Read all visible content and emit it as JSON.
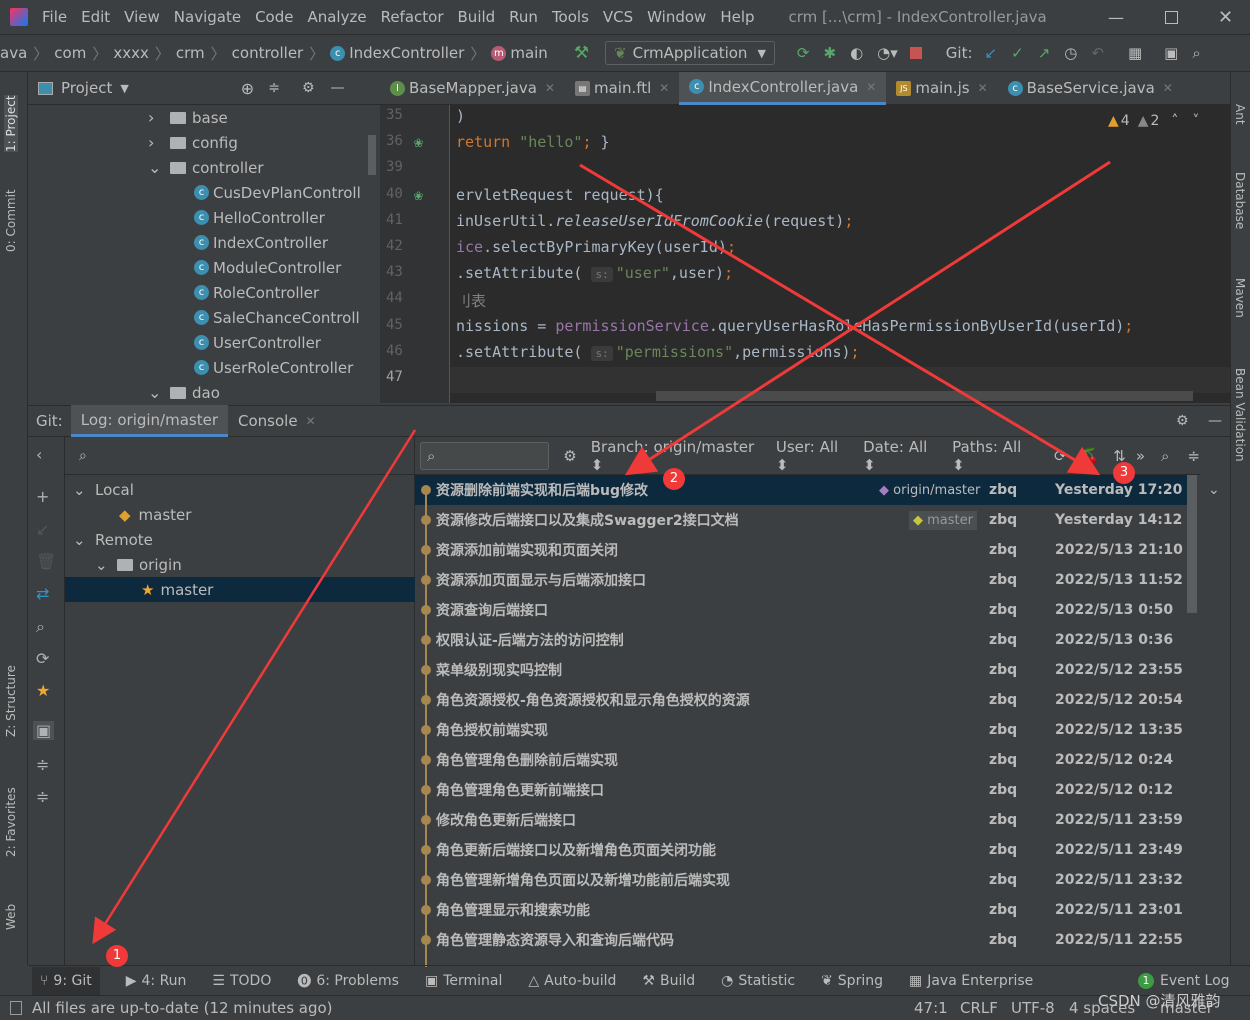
{
  "window": {
    "title": "crm [...\\crm] - IndexController.java"
  },
  "menu": [
    "File",
    "Edit",
    "View",
    "Navigate",
    "Code",
    "Analyze",
    "Refactor",
    "Build",
    "Run",
    "Tools",
    "VCS",
    "Window",
    "Help"
  ],
  "breadcrumb": [
    "ava",
    "com",
    "xxxx",
    "crm",
    "controller",
    "IndexController",
    "main"
  ],
  "run_config": "CrmApplication",
  "git_label": "Git:",
  "project_label": "Project",
  "editor_tabs": [
    "BaseMapper.java",
    "main.ftl",
    "IndexController.java",
    "main.js",
    "BaseService.java"
  ],
  "left_strip": [
    "1: Project",
    "0: Commit",
    "Z: Structure",
    "2: Favorites",
    "Web"
  ],
  "right_strip": [
    "Ant",
    "Database",
    "Maven",
    "Bean Validation"
  ],
  "tree": [
    {
      "label": "base",
      "level": 1,
      "type": "folder",
      "open": false
    },
    {
      "label": "config",
      "level": 1,
      "type": "folder",
      "open": false
    },
    {
      "label": "controller",
      "level": 1,
      "type": "folder",
      "open": true
    },
    {
      "label": "CusDevPlanControll",
      "level": 2,
      "type": "class"
    },
    {
      "label": "HelloController",
      "level": 2,
      "type": "class"
    },
    {
      "label": "IndexController",
      "level": 2,
      "type": "class"
    },
    {
      "label": "ModuleController",
      "level": 2,
      "type": "class"
    },
    {
      "label": "RoleController",
      "level": 2,
      "type": "class"
    },
    {
      "label": "SaleChanceControll",
      "level": 2,
      "type": "class"
    },
    {
      "label": "UserController",
      "level": 2,
      "type": "class"
    },
    {
      "label": "UserRoleController",
      "level": 2,
      "type": "class"
    },
    {
      "label": "dao",
      "level": 1,
      "type": "folder",
      "open": true
    }
  ],
  "editor": {
    "warnings": "4",
    "weak_warnings": "2",
    "lines": [
      {
        "n": "35",
        "html": ")"
      },
      {
        "n": "36",
        "html": "<span class='kw'>return</span> <span class='str'>\"hello\"</span><span class='kw'>;</span> }"
      },
      {
        "n": "39",
        "html": ""
      },
      {
        "n": "40",
        "html": "ervletRequest request){"
      },
      {
        "n": "41",
        "html": "inUserUtil.<span class='it'>releaseUserIdFromCookie</span>(request)<span class='kw'>;</span>"
      },
      {
        "n": "42",
        "html": "<span class='fld'>ice</span>.selectByPrimaryKey(userId)<span class='kw'>;</span>"
      },
      {
        "n": "43",
        "html": ".setAttribute( <span class='hint'>s:</span><span class='str'>\"user\"</span>,user)<span class='kw'>;</span>"
      },
      {
        "n": "44",
        "html": "<span style='color:#808080'>刂表</span>"
      },
      {
        "n": "45",
        "html": "nissions = <span class='fld'>permissionService</span>.queryUserHasRoleHasPermissionByUserId(userId)<span class='kw'>;</span>"
      },
      {
        "n": "46",
        "html": ".setAttribute( <span class='hint'>s:</span><span class='str'>\"permissions\"</span>,permissions)<span class='kw'>;</span>"
      },
      {
        "n": "47",
        "html": ""
      }
    ]
  },
  "git_panel": {
    "label": "Git:",
    "tabs": [
      "Log: origin/master",
      "Console"
    ]
  },
  "branches": {
    "local": "Local",
    "local_master": "master",
    "remote": "Remote",
    "origin": "origin",
    "origin_master": "master"
  },
  "log_toolbar": {
    "branch": "Branch: origin/master",
    "user": "User: All",
    "date": "Date: All",
    "paths": "Paths: All"
  },
  "commits": [
    {
      "msg": "资源删除前端实现和后端bug修改",
      "ref": "origin/master",
      "author": "zbq",
      "date": "Yesterday 17:20",
      "selected": true
    },
    {
      "msg": "资源修改后端接口以及集成Swagger2接口文档",
      "ref": "master",
      "author": "zbq",
      "date": "Yesterday 14:12"
    },
    {
      "msg": "资源添加前端实现和页面关闭",
      "author": "zbq",
      "date": "2022/5/13 21:10"
    },
    {
      "msg": "资源添加页面显示与后端添加接口",
      "author": "zbq",
      "date": "2022/5/13 11:52"
    },
    {
      "msg": "资源查询后端接口",
      "author": "zbq",
      "date": "2022/5/13 0:50"
    },
    {
      "msg": "权限认证-后端方法的访问控制",
      "author": "zbq",
      "date": "2022/5/13 0:36"
    },
    {
      "msg": "菜单级别现实吗控制",
      "author": "zbq",
      "date": "2022/5/12 23:55"
    },
    {
      "msg": "角色资源授权-角色资源授权和显示角色授权的资源",
      "author": "zbq",
      "date": "2022/5/12 20:54"
    },
    {
      "msg": "角色授权前端实现",
      "author": "zbq",
      "date": "2022/5/12 13:35"
    },
    {
      "msg": "角色管理角色删除前后端实现",
      "author": "zbq",
      "date": "2022/5/12 0:24"
    },
    {
      "msg": "角色管理角色更新前端接口",
      "author": "zbq",
      "date": "2022/5/12 0:12"
    },
    {
      "msg": "修改角色更新后端接口",
      "author": "zbq",
      "date": "2022/5/11 23:59"
    },
    {
      "msg": "角色更新后端接口以及新增角色页面关闭功能",
      "author": "zbq",
      "date": "2022/5/11 23:49"
    },
    {
      "msg": "角色管理新增角色页面以及新增功能前后端实现",
      "author": "zbq",
      "date": "2022/5/11 23:32"
    },
    {
      "msg": "角色管理显示和搜索功能",
      "author": "zbq",
      "date": "2022/5/11 23:01"
    },
    {
      "msg": "角色管理静态资源导入和查询后端代码",
      "author": "zbq",
      "date": "2022/5/11 22:55"
    }
  ],
  "bottom_tools": [
    {
      "label": "9: Git",
      "icon": "git-branch-icon"
    },
    {
      "label": "4: Run",
      "icon": "run-icon"
    },
    {
      "label": "TODO",
      "icon": "list-icon"
    },
    {
      "label": "6: Problems",
      "icon": "problems-icon"
    },
    {
      "label": "Terminal",
      "icon": "terminal-icon"
    },
    {
      "label": "Auto-build",
      "icon": "triangle-icon"
    },
    {
      "label": "Build",
      "icon": "hammer-icon"
    },
    {
      "label": "Statistic",
      "icon": "pie-icon"
    },
    {
      "label": "Spring",
      "icon": "leaf-icon"
    },
    {
      "label": "Java Enterprise",
      "icon": "enterprise-icon"
    }
  ],
  "event_log": {
    "count": "1",
    "label": "Event Log"
  },
  "status": {
    "message": "All files are up-to-date (12 minutes ago)",
    "position": "47:1",
    "line_sep": "CRLF",
    "encoding": "UTF-8",
    "indent": "4 spaces",
    "branch": "master",
    "watermark": "CSDN @清风雅韵"
  },
  "annotations": [
    "1",
    "2",
    "3"
  ],
  "colors": {
    "accent": "#4a88c7",
    "selected_row": "#0d293e",
    "annotation_red": "#f03a3a",
    "commit_dot": "#a5874f"
  }
}
